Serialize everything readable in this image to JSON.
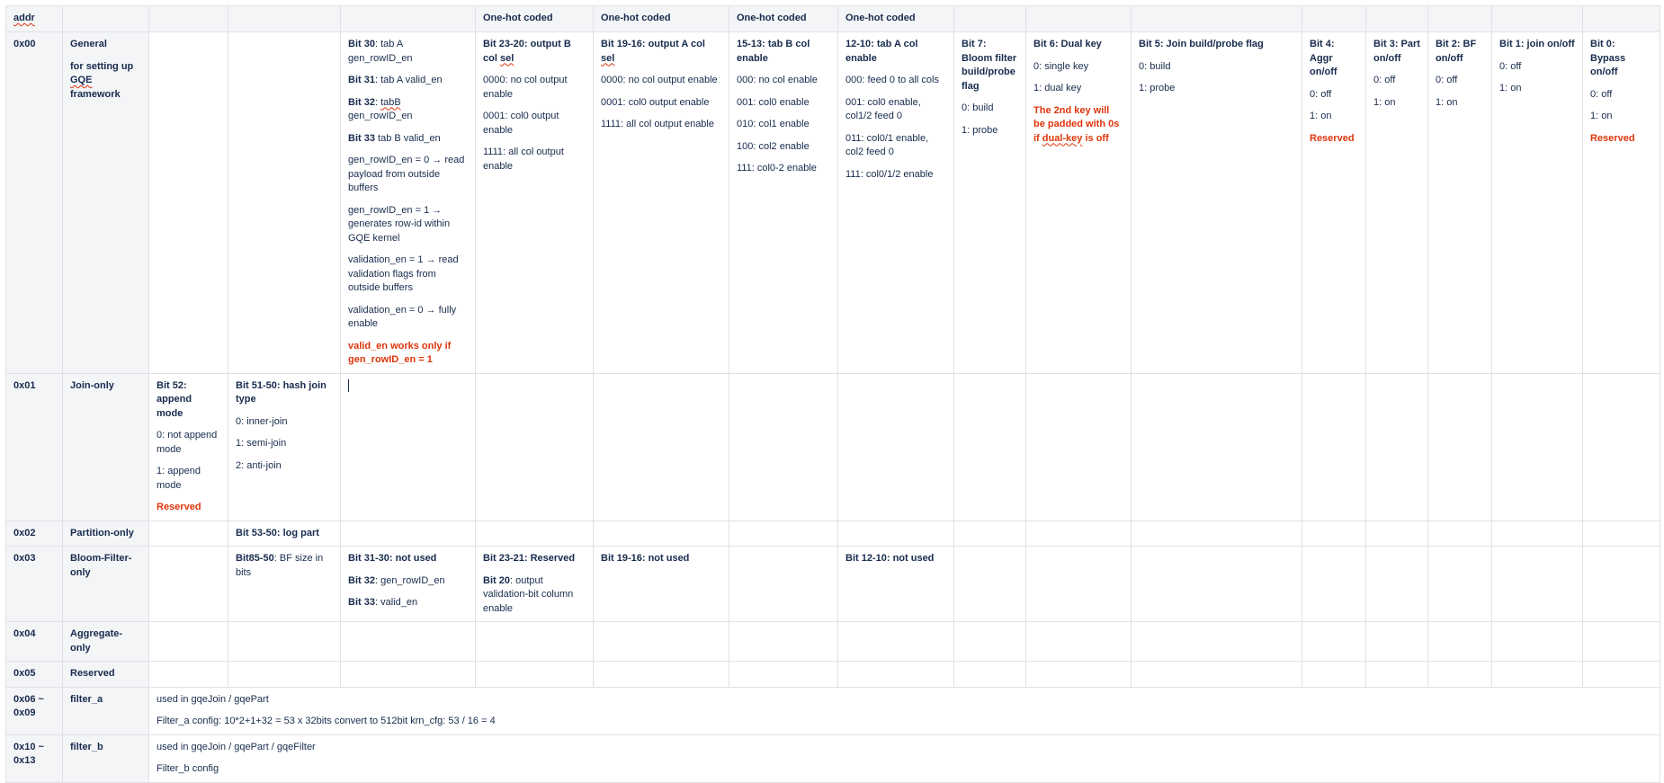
{
  "header": [
    "addr",
    "",
    "",
    "",
    "",
    "One-hot coded",
    "One-hot coded",
    "One-hot coded",
    "One-hot coded",
    "",
    "",
    "",
    "",
    "",
    "",
    "",
    ""
  ],
  "r0": {
    "addr": "0x00",
    "name": "General",
    "desc_a": "for setting up ",
    "desc_gqe": "GQE",
    "desc_b": " framework",
    "c4": {
      "l1_b": "Bit 30",
      "l1_t": ": tab A gen_rowID_en",
      "l2_b": "Bit 31",
      "l2_t": ": tab A valid_en",
      "l3_b": "Bit 32",
      "l3_t1": ": ",
      "l3_sq": "tabB",
      "l3_t2": " gen_rowID_en",
      "l4_b": "Bit 33",
      "l4_t": " tab B valid_en",
      "l5": "gen_rowID_en = 0 → read payload from outside buffers",
      "l6": "gen_rowID_en = 1 → generates row-id within GQE kernel",
      "l7": "validation_en = 1 → read validation flags from outside buffers",
      "l8": "validation_en = 0 → fully enable",
      "l9": "valid_en works only if gen_rowID_en = 1"
    },
    "c5": {
      "t1": "Bit 23-20: output B col ",
      "t_sq": "sel",
      "o1": "0000: no col output enable",
      "o2": "0001: col0 output enable",
      "o3": "1111: all col output enable"
    },
    "c6": {
      "t1": "Bit 19-16: output A col ",
      "t_sq": "sel",
      "o1": "0000: no col output enable",
      "o2": "0001: col0 output enable",
      "o3": "1111: all col output enable"
    },
    "c7": {
      "t": "15-13: tab B col enable",
      "o1": "000: no col enable",
      "o2": "001: col0 enable",
      "o3": "010: col1 enable",
      "o4": "100: col2 enable",
      "o5": "111: col0-2 enable"
    },
    "c8": {
      "t": "12-10: tab A col enable",
      "o1": "000: feed 0 to all cols",
      "o2": "001: col0 enable, col1/2 feed 0",
      "o3": "011: col0/1 enable, col2 feed 0",
      "o4": "111: col0/1/2 enable"
    },
    "c9": {
      "t": "Bit 7: Bloom filter build/probe flag",
      "o1": "0: build",
      "o2": "1: probe"
    },
    "c10": {
      "t": "Bit 6: Dual key",
      "o1": "0: single key",
      "o2": "1: dual key",
      "n1": "The 2nd key will be padded with 0s if ",
      "n_sq": "dual-key",
      "n2": " is off"
    },
    "c11": {
      "t": "Bit 5: Join build/probe flag",
      "o1": "0: build",
      "o2": "1: probe"
    },
    "c12": {
      "t": "Bit 4: Aggr on/off",
      "o1": "0: off",
      "o2": "1: on",
      "n": "Reserved"
    },
    "c13": {
      "t": "Bit 3: Part on/off",
      "o1": "0: off",
      "o2": "1: on"
    },
    "c14": {
      "t": "Bit 2: BF on/off",
      "o1": "0: off",
      "o2": "1: on"
    },
    "c15": {
      "t": "Bit 1: join on/off",
      "o1": "0: off",
      "o2": "1: on"
    },
    "c16": {
      "t": "Bit 0: Bypass on/off",
      "o1": "0: off",
      "o2": "1: on",
      "n": "Reserved"
    }
  },
  "r1": {
    "addr": "0x01",
    "name": "Join-only",
    "c2": {
      "t": "Bit 52: append mode",
      "o1": "0: not append mode",
      "o2": "1: append mode",
      "n": "Reserved"
    },
    "c3": {
      "t": "Bit 51-50: hash join type",
      "o1": "0: inner-join",
      "o2": "1: semi-join",
      "o3": "2: anti-join"
    }
  },
  "r2": {
    "addr": "0x02",
    "name": "Partition-only",
    "c3": "Bit 53-50: log part"
  },
  "r3": {
    "addr": "0x03",
    "name": "Bloom-Filter-only",
    "c3_b": "Bit85-50",
    "c3_t": ": BF size in bits",
    "c4": {
      "l1": "Bit 31-30: not used",
      "l2_b": "Bit 32",
      "l2_t": ": gen_rowID_en",
      "l3_b": "Bit 33",
      "l3_t": ": valid_en"
    },
    "c5": {
      "l1": "Bit 23-21: Reserved",
      "l2_b": "Bit 20",
      "l2_t": ": output validation-bit column enable"
    },
    "c6": "Bit 19-16: not used",
    "c8": "Bit 12-10: not used"
  },
  "r4": {
    "addr": "0x04",
    "name": "Aggregate-only"
  },
  "r5": {
    "addr": "0x05",
    "name": "Reserved"
  },
  "r6": {
    "addr": "0x06 ~ 0x09",
    "name": "filter_a",
    "l1": "used in gqeJoin / gqePart",
    "l2": "Filter_a config: 10*2+1+32 = 53 x 32bits convert to 512bit krn_cfg: 53 / 16 = 4"
  },
  "r7": {
    "addr": "0x10  ~ 0x13",
    "name": "filter_b",
    "l1": "used in gqeJoin / gqePart / gqeFilter",
    "l2": "Filter_b config"
  }
}
